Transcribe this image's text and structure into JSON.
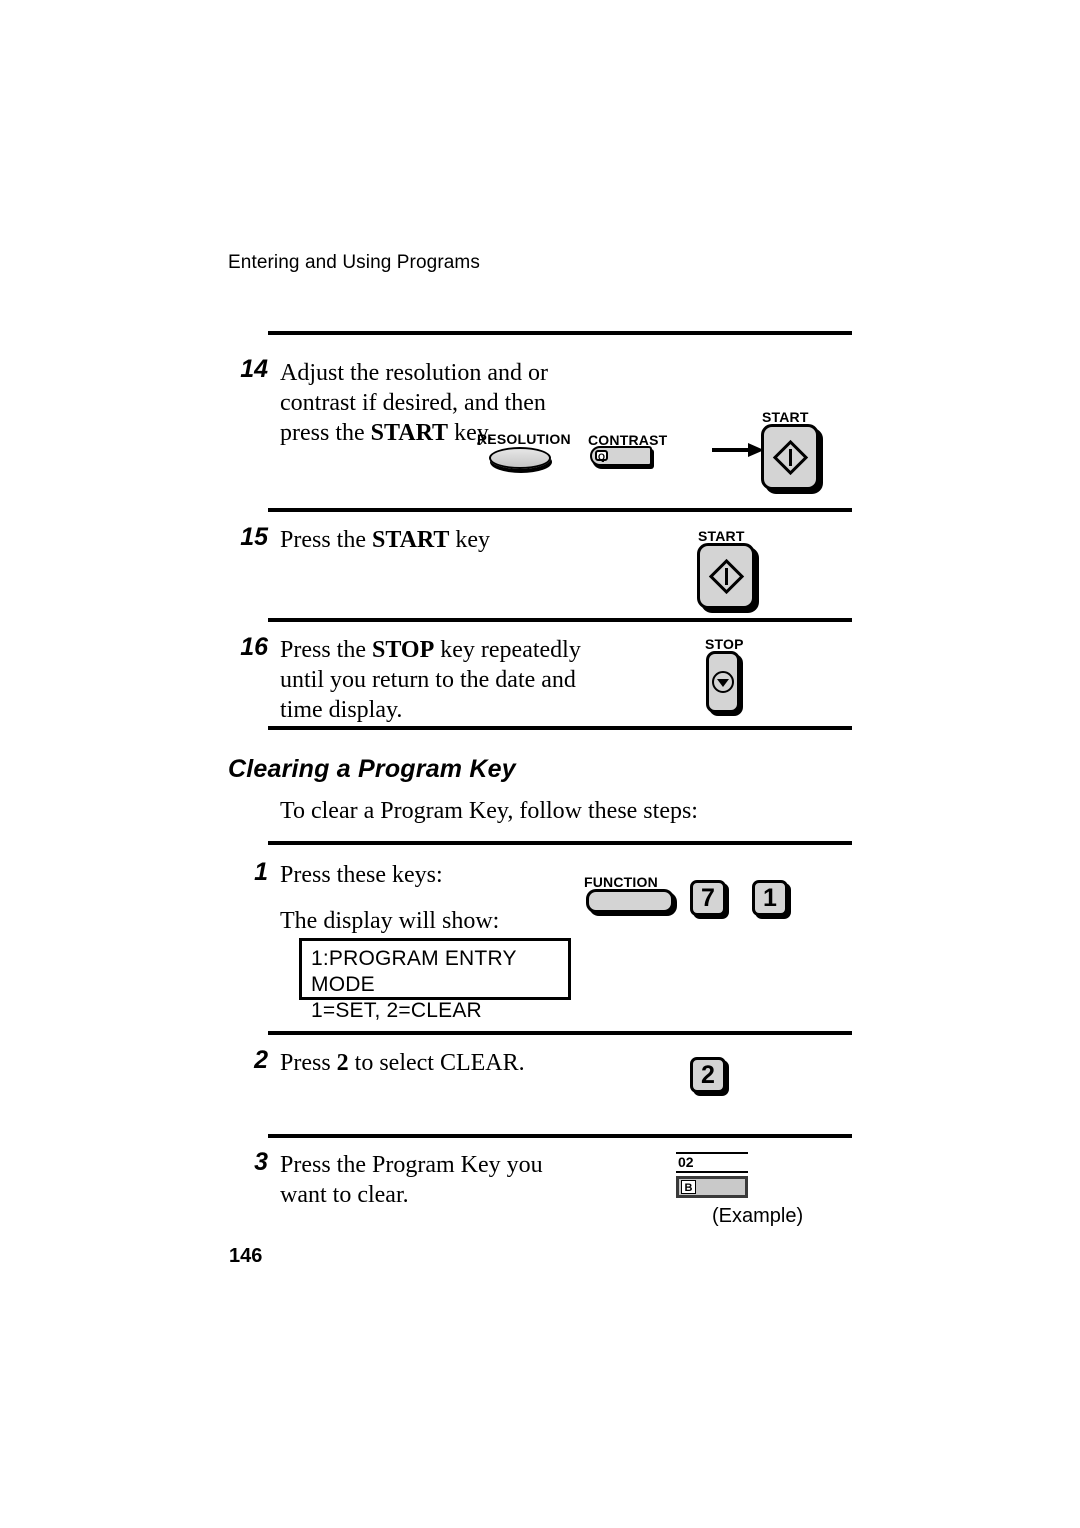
{
  "page": {
    "running_header": "Entering and Using Programs",
    "page_number": "146"
  },
  "steps": [
    {
      "number": "14",
      "text_html": "Adjust the resolution and or contrast if desired, and then press the <b>START</b> key.",
      "text_plain": "Adjust the resolution and or contrast if desired, and then press the START key."
    },
    {
      "number": "15",
      "text_html": "Press the <b>START</b> key",
      "text_plain": "Press the START key"
    },
    {
      "number": "16",
      "text_html": "Press the <b>STOP</b> key repeatedly until you return to the date and time display.",
      "text_plain": "Press the STOP key repeatedly until you return to the date and time display."
    }
  ],
  "section": {
    "heading": "Clearing a Program Key",
    "intro": "To clear a Program Key, follow these steps:"
  },
  "clear_steps": [
    {
      "number": "1",
      "text_plain": "Press these keys:",
      "secondary_text": "The display will show:"
    },
    {
      "number": "2",
      "text_html": "Press <b>2</b> to select CLEAR.",
      "text_plain": "Press 2 to select CLEAR."
    },
    {
      "number": "3",
      "text_plain": "Press the Program Key you want to clear."
    }
  ],
  "controls": {
    "resolution_label": "RESOLUTION",
    "contrast_label": "CONTRAST",
    "contrast_glyph": "Q",
    "start_label": "START",
    "stop_label": "STOP",
    "function_label": "FUNCTION",
    "key_7": "7",
    "key_1": "1",
    "key_2": "2"
  },
  "lcd": {
    "line1": "1:PROGRAM ENTRY MODE",
    "line2": "1=SET, 2=CLEAR"
  },
  "program_key_example": {
    "number": "02",
    "letter": "B",
    "caption": "(Example)"
  },
  "colors": {
    "key_face": "#d4d4d4",
    "key_outline": "#000000",
    "paper": "#ffffff",
    "text": "#000000"
  }
}
